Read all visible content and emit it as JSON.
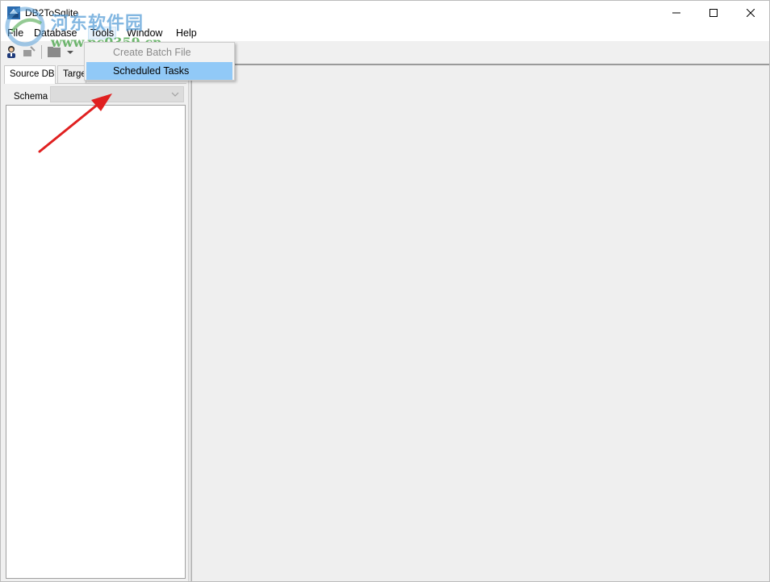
{
  "window": {
    "title": "DB2ToSqlite",
    "controls": {
      "minimize": "minimize",
      "maximize": "maximize",
      "close": "close"
    }
  },
  "watermark": {
    "chinese": "河东软件园",
    "url": "www.pc0359.cn"
  },
  "menubar": {
    "items": [
      "File",
      "Database",
      "Tools",
      "Window",
      "Help"
    ],
    "active": "Tools"
  },
  "toolbar": {
    "icons": [
      "connect-user-icon",
      "disconnect-icon",
      "folder-icon",
      "dropdown-arrow-icon"
    ]
  },
  "tools_menu": {
    "items": [
      {
        "label": "Create Batch File",
        "enabled": false
      },
      {
        "label": "Scheduled Tasks",
        "enabled": true,
        "highlighted": true
      }
    ]
  },
  "left_panel": {
    "tabs": [
      "Source DB",
      "Targe"
    ],
    "active_tab": "Source DB",
    "schema_label": "Schema",
    "schema_value": ""
  },
  "colors": {
    "highlight": "#91c9f7",
    "arrow": "#e02020",
    "panel_bg": "#f0f0f0"
  }
}
